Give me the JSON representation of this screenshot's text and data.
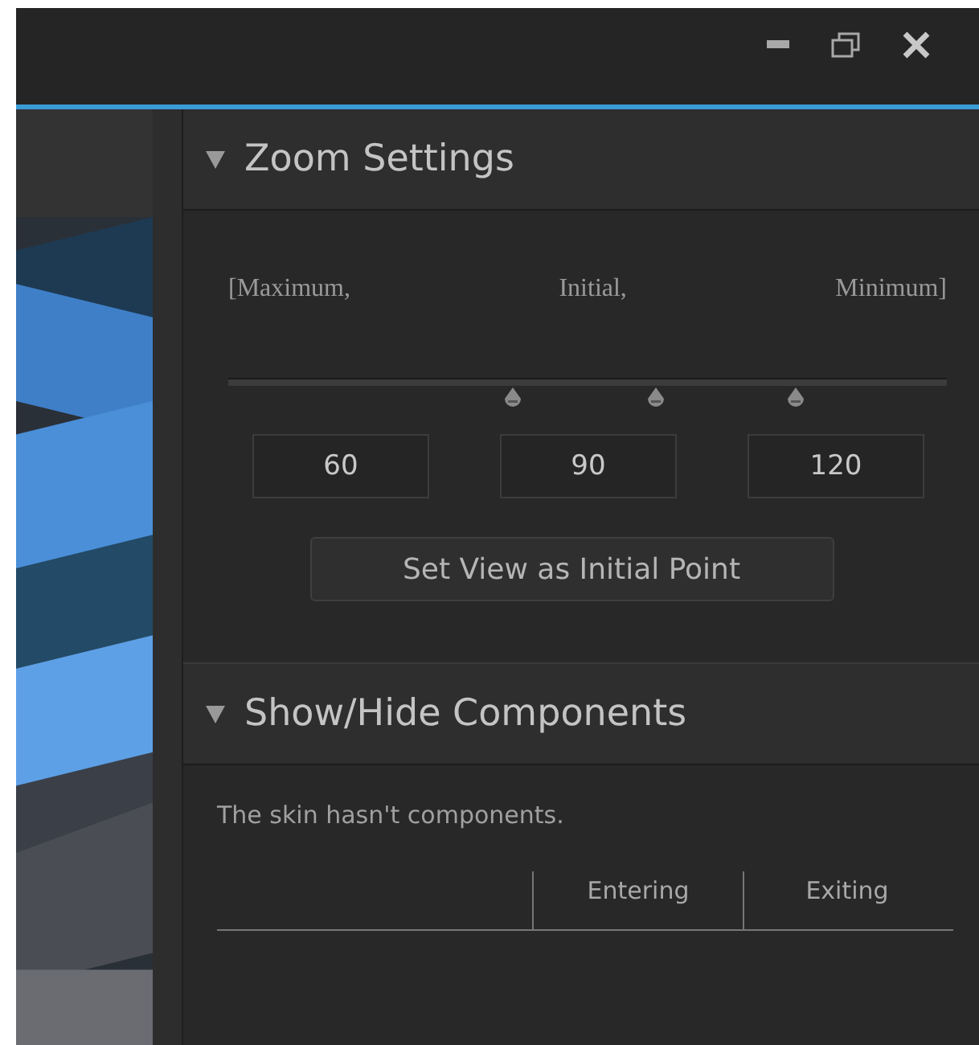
{
  "zoom_settings": {
    "title": "Zoom Settings",
    "expanded": true,
    "labels": [
      "[Maximum,",
      "Initial,",
      "Minimum]"
    ],
    "slider": {
      "thumbs": [
        {
          "level": 0.395
        },
        {
          "level": 0.594
        },
        {
          "level": 0.79
        }
      ]
    },
    "fields": [
      "60",
      "90",
      "120"
    ],
    "button": "Set View as Initial Point"
  },
  "components": {
    "title": "Show/Hide Components",
    "expanded": true,
    "message": "The skin hasn't components.",
    "columns": [
      "Entering",
      "Exiting"
    ]
  }
}
